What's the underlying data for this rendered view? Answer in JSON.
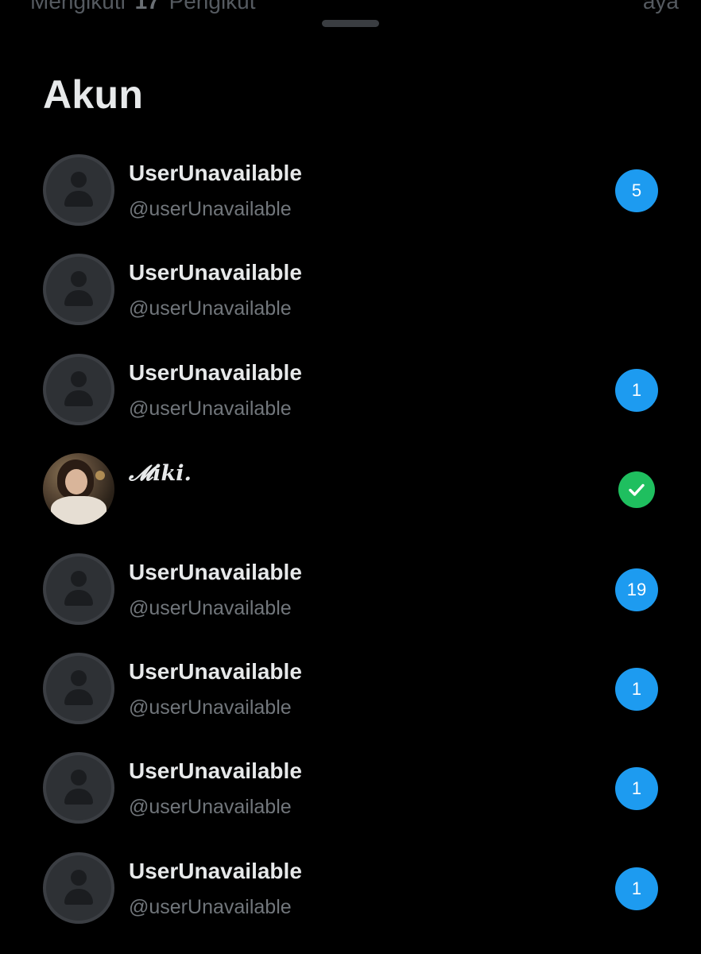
{
  "colors": {
    "background": "#000000",
    "badge": "#1d9bf0",
    "selected_check": "#1fbf5f",
    "primary_text": "#e7e9ea",
    "secondary_text": "#71767b"
  },
  "behind_sheet": {
    "following_label": "Mengikuti",
    "following_count_label": "17",
    "followers_label": "Pengikut",
    "right_text": "aya"
  },
  "sheet": {
    "title": "Akun"
  },
  "accounts": [
    {
      "name": "UserUnavailable",
      "handle": "@userUnavailable",
      "badge": "5",
      "avatar_icon": "default-avatar-icon"
    },
    {
      "name": "UserUnavailable",
      "handle": "@userUnavailable",
      "badge": "",
      "avatar_icon": "default-avatar-icon"
    },
    {
      "name": "UserUnavailable",
      "handle": "@userUnavailable",
      "badge": "1",
      "avatar_icon": "default-avatar-icon"
    },
    {
      "name": "𝓜iki.",
      "handle": "",
      "badge": "",
      "selected": true,
      "avatar_icon": "profile-photo",
      "status_icon": "check-circle-icon"
    },
    {
      "name": "UserUnavailable",
      "handle": "@userUnavailable",
      "badge": "19",
      "avatar_icon": "default-avatar-icon"
    },
    {
      "name": "UserUnavailable",
      "handle": "@userUnavailable",
      "badge": "1",
      "avatar_icon": "default-avatar-icon"
    },
    {
      "name": "UserUnavailable",
      "handle": "@userUnavailable",
      "badge": "1",
      "avatar_icon": "default-avatar-icon"
    },
    {
      "name": "UserUnavailable",
      "handle": "@userUnavailable",
      "badge": "1",
      "avatar_icon": "default-avatar-icon"
    }
  ]
}
